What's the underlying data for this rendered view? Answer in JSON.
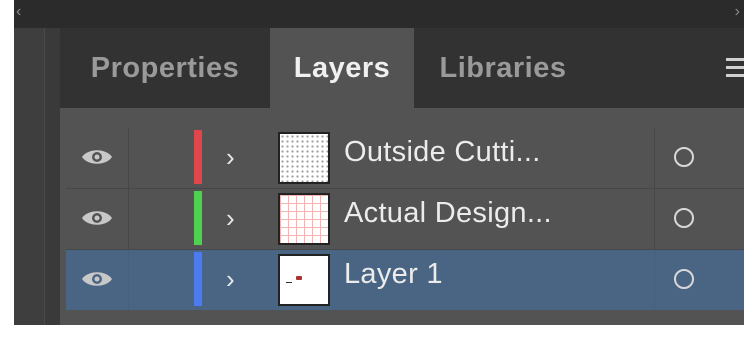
{
  "tabs": [
    {
      "label": "Properties",
      "active": false
    },
    {
      "label": "Layers",
      "active": true
    },
    {
      "label": "Libraries",
      "active": false
    }
  ],
  "layers": [
    {
      "name": "Outside Cutti...",
      "color": "#e0474c",
      "thumbnail": "dot-pattern",
      "selected": false,
      "visible": true
    },
    {
      "name": "Actual Design...",
      "color": "#4fd24f",
      "thumbnail": "pink-grid",
      "selected": false,
      "visible": true
    },
    {
      "name": "Layer 1",
      "color": "#4c7bf0",
      "thumbnail": "small-mark",
      "selected": true,
      "visible": true
    }
  ],
  "icons": {
    "visibility": "eye-icon",
    "expand": "chevron-right-icon",
    "target": "circle-target-icon",
    "menu": "hamburger-menu-icon",
    "collapse_left": "double-chevron-left-icon",
    "collapse_right": "double-chevron-right-icon"
  },
  "colors": {
    "panel_bg": "#535353",
    "tab_bar_bg": "#323232",
    "selected_row": "#4a6583"
  }
}
